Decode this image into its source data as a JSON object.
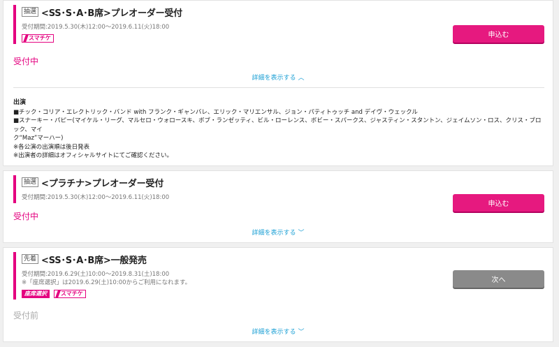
{
  "cards": [
    {
      "tag": "抽選",
      "title": "<SS･S･A･B席>プレオーダー受付",
      "period": "受付期間:2019.5.30(木)12:00〜2019.6.11(火)18:00",
      "badge": "スマチケ",
      "button": "申込む",
      "status": "受付中",
      "toggle": "詳細を表示する",
      "toggle_icon": "chevron-up",
      "details": {
        "heading": "出演",
        "lines": [
          "■チック・コリア・エレクトリック・バンド with フランク・ギャンバレ、エリック・マリエンサル、ジョン・パティトゥッチ and デイヴ・ウェックル",
          "■スナーキー・パピー(マイケル・リーグ、マルセロ・ウォロースキ、ボブ・ランゼッティ、ビル・ローレンス、ボビー・スパークス、ジャスティン・スタントン、ジェイムソン・ロス、クリス・ブロック、マイ",
          "ク“Maz”マーハー)",
          "※各公演の出演順は後日発表",
          "※出演者の詳細はオフィシャルサイトにてご確認ください。"
        ]
      }
    },
    {
      "tag": "抽選",
      "title": "<プラチナ>プレオーダー受付",
      "period": "受付期間:2019.5.30(木)12:00〜2019.6.11(火)18:00",
      "button": "申込む",
      "status": "受付中",
      "toggle": "詳細を表示する",
      "toggle_icon": "chevron-down"
    },
    {
      "tag": "先着",
      "title": "<SS･S･A･B席>一般発売",
      "period": "受付期間:2019.6.29(土)10:00〜2019.8.31(土)18:00",
      "note": "※「座席選択」は2019.6.29(土)10:00からご利用になれます。",
      "badge_seat": "座席選択",
      "badge": "スマチケ",
      "button": "次へ",
      "status": "受付前",
      "toggle": "詳細を表示する",
      "toggle_icon": "chevron-down"
    }
  ],
  "colors": {
    "accent": "#e4007f",
    "link": "#1a9fd4",
    "disabled": "#8a8a8a"
  }
}
